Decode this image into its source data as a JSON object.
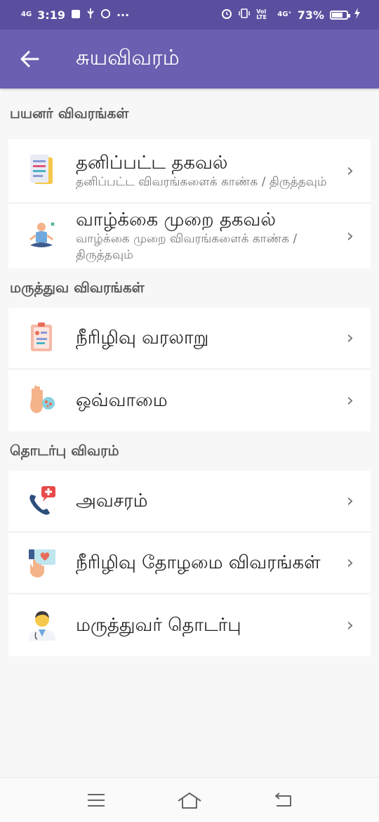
{
  "status_bar": {
    "network": "4G",
    "time": "3:19",
    "dots": "···",
    "volte": "Vol LTE",
    "network2": "4G⁺",
    "battery": "73%",
    "battery_level": 0.73
  },
  "app_bar": {
    "back_icon": "arrow-back-icon",
    "title": "சுயவிவரம்"
  },
  "sections": [
    {
      "header": "பயனர் விவரங்கள்",
      "items": [
        {
          "title": "தனிப்பட்ட தகவல்",
          "subtitle": "தனிப்பட்ட விவரங்களைக் காண்க / திருத்தவும்",
          "icon": "document-icon"
        },
        {
          "title": "வாழ்க்கை முறை தகவல்",
          "subtitle": "வாழ்க்கை முறை விவரங்களைக் காண்க / திருத்தவும்",
          "icon": "meditation-icon"
        }
      ]
    },
    {
      "header": "மருத்துவ விவரங்கள்",
      "items": [
        {
          "title": "நீரிழிவு வரலாறு",
          "icon": "medical-report-icon"
        },
        {
          "title": "ஒவ்வாமை",
          "icon": "allergy-hand-icon"
        }
      ]
    },
    {
      "header": "தொடர்பு விவரம்",
      "items": [
        {
          "title": "அவசரம்",
          "icon": "emergency-phone-icon"
        },
        {
          "title": "நீரிழிவு தோழமை விவரங்கள்",
          "icon": "buddy-heart-icon"
        },
        {
          "title": "மருத்துவர் தொடர்பு",
          "icon": "doctor-icon"
        }
      ]
    }
  ],
  "chevron": "›",
  "nav_bar": {
    "menu_icon": "menu-icon",
    "home_icon": "home-icon",
    "back_icon": "back-nav-icon"
  }
}
